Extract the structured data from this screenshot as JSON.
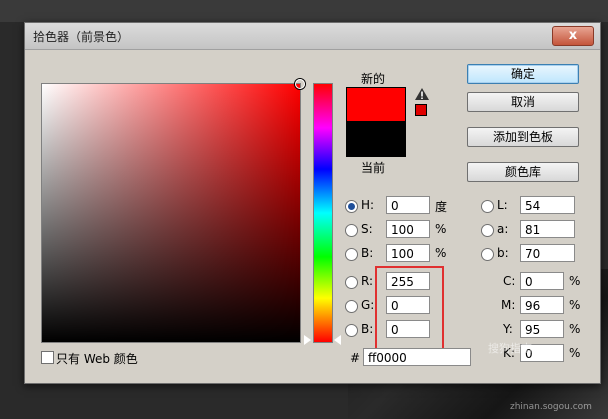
{
  "dialog": {
    "title": "拾色器（前景色）",
    "close_label": "x"
  },
  "preview": {
    "new_label": "新的",
    "current_label": "当前",
    "new_color": "#ff0000",
    "current_color": "#000000"
  },
  "buttons": {
    "ok": "确定",
    "cancel": "取消",
    "add_swatch": "添加到色板",
    "libraries": "颜色库"
  },
  "hsb": {
    "h_label": "H:",
    "h_value": "0",
    "h_unit": "度",
    "s_label": "S:",
    "s_value": "100",
    "s_unit": "%",
    "b_label": "B:",
    "b_value": "100",
    "b_unit": "%",
    "selected": "H"
  },
  "rgb": {
    "r_label": "R:",
    "r_value": "255",
    "g_label": "G:",
    "g_value": "0",
    "b_label": "B:",
    "b_value": "0"
  },
  "lab": {
    "l_label": "L:",
    "l_value": "54",
    "a_label": "a:",
    "a_value": "81",
    "b_label": "b:",
    "b_value": "70"
  },
  "cmyk": {
    "c_label": "C:",
    "c_value": "0",
    "c_unit": "%",
    "m_label": "M:",
    "m_value": "96",
    "m_unit": "%",
    "y_label": "Y:",
    "y_value": "95",
    "y_unit": "%",
    "k_label": "K:",
    "k_value": "0",
    "k_unit": "%"
  },
  "hex": {
    "label": "#",
    "value": "ff0000"
  },
  "web_only": {
    "label": "只有 Web 颜色",
    "checked": false
  },
  "watermark": {
    "text": "搜狗指南",
    "url": "zhinan.sogou.com"
  }
}
